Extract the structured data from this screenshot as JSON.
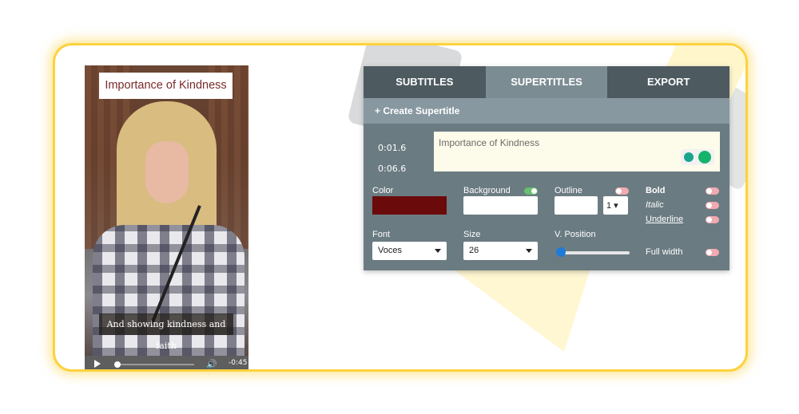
{
  "video": {
    "title_overlay": "Importance of Kindness",
    "subtitle_overlay": "And showing kindness and faith",
    "player": {
      "time_remaining": "-0:45"
    }
  },
  "panel": {
    "tabs": [
      {
        "label": "SUBTITLES"
      },
      {
        "label": "SUPERTITLES"
      },
      {
        "label": "EXPORT"
      }
    ],
    "create_label": "+ Create Supertitle",
    "entry": {
      "start_time": "0:01.6",
      "end_time": "0:06.6",
      "text": "Importance of Kindness",
      "close": "×"
    },
    "style": {
      "color_label": "Color",
      "color_value": "#6b0a0a",
      "background_label": "Background",
      "background_enabled": true,
      "outline_label": "Outline",
      "outline_enabled": false,
      "outline_width": "1",
      "bold_label": "Bold",
      "italic_label": "Italic",
      "underline_label": "Underline",
      "font_label": "Font",
      "font_value": "Voces",
      "size_label": "Size",
      "size_value": "26",
      "vposition_label": "V. Position",
      "fullwidth_label": "Full width"
    }
  }
}
